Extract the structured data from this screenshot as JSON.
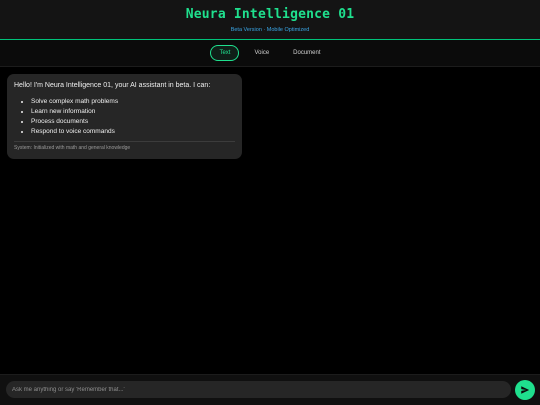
{
  "header": {
    "title": "Neura Intelligence 01",
    "subtitle": "Beta Version · Mobile Optimized"
  },
  "tabs": [
    {
      "label": "Text",
      "active": true
    },
    {
      "label": "Voice",
      "active": false
    },
    {
      "label": "Document",
      "active": false
    }
  ],
  "messages": [
    {
      "intro": "Hello! I'm Neura Intelligence 01, your AI assistant in beta. I can:",
      "capabilities": [
        "Solve complex math problems",
        "Learn new information",
        "Process documents",
        "Respond to voice commands"
      ],
      "system_note": "System: Initialized with math and general knowledge"
    }
  ],
  "input": {
    "placeholder": "Ask me anything or say 'Remember that...'",
    "value": ""
  },
  "send": {
    "icon": "send-arrow-icon"
  },
  "colors": {
    "accent": "#1fe08e",
    "subtitle": "#3aa6e6",
    "bubble": "#262626",
    "background": "#000000"
  }
}
